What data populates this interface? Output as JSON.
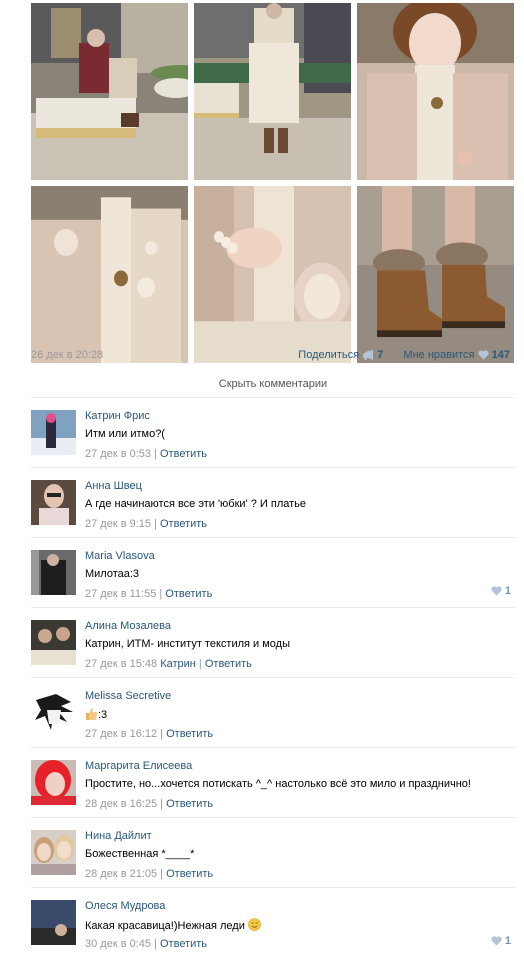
{
  "photos": [
    {
      "name": "photo-mall-seated",
      "alt": "mall"
    },
    {
      "name": "photo-mall-standing",
      "alt": "mall"
    },
    {
      "name": "photo-portrait",
      "alt": "portrait"
    },
    {
      "name": "photo-dress-detail",
      "alt": "detail"
    },
    {
      "name": "photo-hands-bag",
      "alt": "bag"
    },
    {
      "name": "photo-boots",
      "alt": "boots"
    }
  ],
  "post": {
    "date": "26 дек в 20:28",
    "share_label": "Поделиться",
    "share_count": "7",
    "like_label": "Мне нравится",
    "like_count": "147"
  },
  "hide_comments_label": "Скрыть комментарии",
  "comments": [
    {
      "author": "Катрин Фрис",
      "text": "Итм или итмо?(",
      "time": "27 дек в 0:53",
      "reply_to": "",
      "reply_label": "Ответить",
      "likes": "",
      "avatar": "pink-hair-snow"
    },
    {
      "author": "Анна Швец",
      "text": "А где начинаются все эти 'юбки' ? И платье",
      "time": "27 дек в 9:15",
      "reply_to": "",
      "reply_label": "Ответить",
      "likes": "",
      "avatar": "glasses-girl"
    },
    {
      "author": "Maria Vlasova",
      "text": "Милотаа:3",
      "time": "27 дек в 11:55",
      "reply_to": "",
      "reply_label": "Ответить",
      "likes": "1",
      "avatar": "dark-outfit"
    },
    {
      "author": "Алина Мозалева",
      "text": "Катрин, ИТМ- институт текстиля и моды",
      "time": "27 дек в 15:48",
      "reply_to": "Катрин",
      "reply_label": "Ответить",
      "likes": "",
      "avatar": "dinner-table"
    },
    {
      "author": "Melissa Secretive",
      "text": ":3",
      "time": "27 дек в 16:12",
      "reply_to": "",
      "reply_label": "Ответить",
      "likes": "",
      "avatar": "anime-drawing",
      "text_prefix_icon": "thumbs-up"
    },
    {
      "author": "Маргарита Елисеева",
      "text": "Простите, но...хочется потискать ^_^ настолько всё это мило и празднично!",
      "time": "28 дек в 16:25",
      "reply_to": "",
      "reply_label": "Ответить",
      "likes": "",
      "avatar": "red-hair"
    },
    {
      "author": "Нина Дайлит",
      "text": "Божественная *____*",
      "time": "28 дек в 21:05",
      "reply_to": "",
      "reply_label": "Ответить",
      "likes": "",
      "avatar": "two-girls"
    },
    {
      "author": "Олеся Мудрова",
      "text": "Какая красавица!)Нежная леди",
      "time": "30 дек в 0:45",
      "reply_to": "",
      "reply_label": "Ответить",
      "likes": "1",
      "avatar": "blue-photo",
      "text_suffix_icon": "smile"
    }
  ],
  "colors": {
    "link": "#2b587a",
    "meta": "#999999",
    "divider": "#e7ebf0",
    "like": "#7896b2"
  }
}
